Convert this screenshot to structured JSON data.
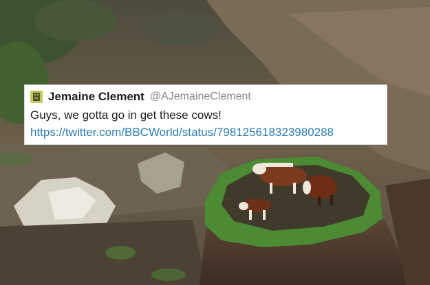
{
  "tweet": {
    "display_name": "Jemaine Clement",
    "handle": "@AJemaineClement",
    "text": "Guys, we gotta go in get these cows!",
    "link": "https://twitter.com/BBCWorld/status/798125618323980288",
    "avatar_icon": "slack-default-avatar-icon"
  },
  "colors": {
    "link": "#2b7bb9",
    "name": "#1c1c1c",
    "handle": "#8a8a8a",
    "avatar_bg": "#c3c95a"
  }
}
